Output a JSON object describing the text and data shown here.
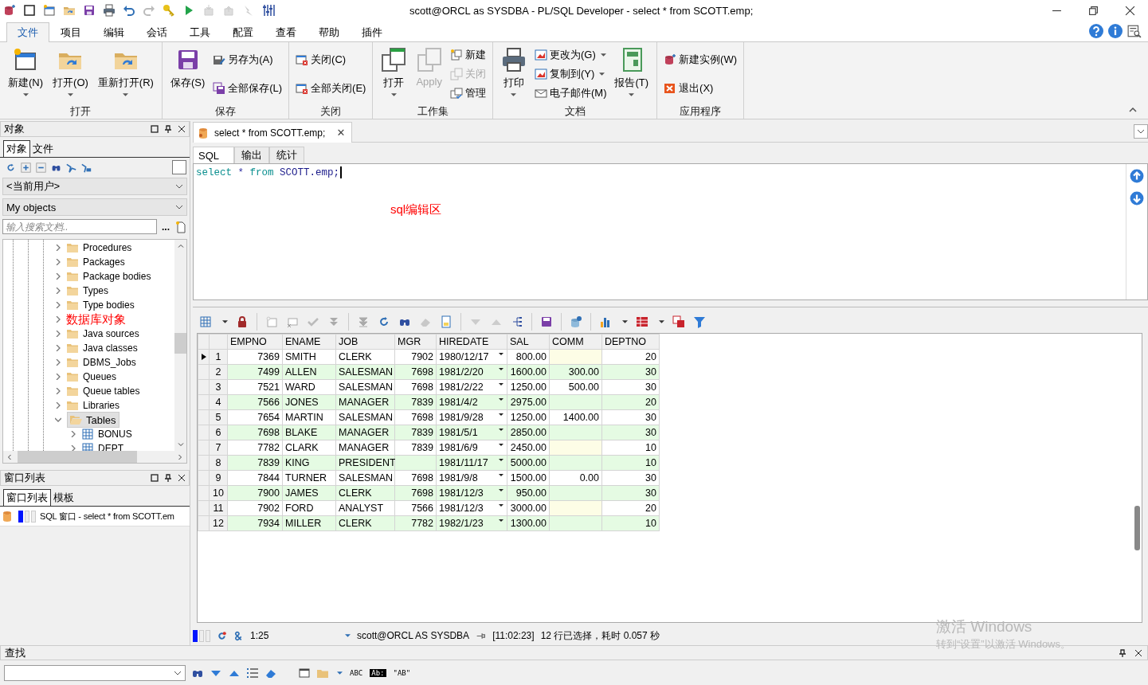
{
  "window": {
    "title": "scott@ORCL as SYSDBA - PL/SQL Developer - select * from SCOTT.emp;"
  },
  "menu_tabs": [
    {
      "label": "文件",
      "selected": true
    },
    {
      "label": "项目",
      "selected": false
    },
    {
      "label": "编辑",
      "selected": false
    },
    {
      "label": "会话",
      "selected": false
    },
    {
      "label": "工具",
      "selected": false
    },
    {
      "label": "配置",
      "selected": false
    },
    {
      "label": "查看",
      "selected": false
    },
    {
      "label": "帮助",
      "selected": false
    },
    {
      "label": "插件",
      "selected": false
    }
  ],
  "ribbon": [
    {
      "label": "打开",
      "buttons": [
        {
          "kind": "large",
          "label": "新建(N)",
          "dropdown": true,
          "disabled": false
        },
        {
          "kind": "large",
          "label": "打开(O)",
          "dropdown": true,
          "disabled": false
        },
        {
          "kind": "large",
          "label": "重新打开(R)",
          "dropdown": true,
          "disabled": false
        }
      ]
    },
    {
      "label": "保存",
      "buttons": [
        {
          "kind": "large",
          "label": "保存(S)",
          "dropdown": false,
          "disabled": false
        },
        {
          "kind": "small",
          "label": "另存为(A)",
          "dropdown": false,
          "disabled": false
        },
        {
          "kind": "small",
          "label": "全部保存(L)",
          "dropdown": false,
          "disabled": false
        }
      ]
    },
    {
      "label": "关闭",
      "buttons": [
        {
          "kind": "small",
          "label": "关闭(C)",
          "dropdown": false,
          "disabled": false
        },
        {
          "kind": "small",
          "label": "全部关闭(E)",
          "dropdown": false,
          "disabled": false
        }
      ]
    },
    {
      "label": "工作集",
      "buttons": [
        {
          "kind": "large",
          "label": "打开",
          "dropdown": true,
          "disabled": false
        },
        {
          "kind": "large",
          "label": "Apply",
          "dropdown": false,
          "disabled": true
        },
        {
          "kind": "small",
          "label": "新建",
          "dropdown": false,
          "disabled": false
        },
        {
          "kind": "small",
          "label": "关闭",
          "dropdown": false,
          "disabled": true
        },
        {
          "kind": "small",
          "label": "管理",
          "dropdown": false,
          "disabled": false
        }
      ]
    },
    {
      "label": "文档",
      "buttons": [
        {
          "kind": "large",
          "label": "打印",
          "dropdown": true,
          "disabled": false
        },
        {
          "kind": "small",
          "label": "更改为(G)",
          "dropdown": true,
          "disabled": false
        },
        {
          "kind": "small",
          "label": "复制到(Y)",
          "dropdown": true,
          "disabled": false
        },
        {
          "kind": "small",
          "label": "电子邮件(M)",
          "dropdown": false,
          "disabled": false
        },
        {
          "kind": "large",
          "label": "报告(T)",
          "dropdown": true,
          "disabled": false
        }
      ]
    },
    {
      "label": "应用程序",
      "buttons": [
        {
          "kind": "small",
          "label": "新建实例(W)",
          "dropdown": false,
          "disabled": false
        },
        {
          "kind": "small",
          "label": "退出(X)",
          "dropdown": false,
          "disabled": false
        }
      ]
    }
  ],
  "objects_panel": {
    "title": "对象",
    "tabs": [
      {
        "label": "对象",
        "selected": true
      },
      {
        "label": "文件",
        "selected": false
      }
    ],
    "owner_select": "<当前用户>",
    "filter_select": "My objects",
    "search": {
      "placeholder": "输入搜索文档.."
    },
    "more_button": "...",
    "tree": [
      {
        "kind": "folder",
        "label": "Procedures",
        "expanded": false,
        "selected": false
      },
      {
        "kind": "folder",
        "label": "Packages",
        "expanded": false,
        "selected": false
      },
      {
        "kind": "folder",
        "label": "Package bodies",
        "expanded": false,
        "selected": false
      },
      {
        "kind": "folder",
        "label": "Types",
        "expanded": false,
        "selected": false
      },
      {
        "kind": "folder",
        "label": "Type bodies",
        "expanded": false,
        "selected": false
      },
      {
        "kind": "folder",
        "annotation": "数据库对象",
        "expanded": false,
        "selected": false
      },
      {
        "kind": "folder",
        "label": "Java sources",
        "expanded": false,
        "selected": false
      },
      {
        "kind": "folder",
        "label": "Java classes",
        "expanded": false,
        "selected": false
      },
      {
        "kind": "folder",
        "label": "DBMS_Jobs",
        "expanded": false,
        "selected": false
      },
      {
        "kind": "folder",
        "label": "Queues",
        "expanded": false,
        "selected": false
      },
      {
        "kind": "folder",
        "label": "Queue tables",
        "expanded": false,
        "selected": false
      },
      {
        "kind": "folder",
        "label": "Libraries",
        "expanded": false,
        "selected": false
      },
      {
        "kind": "folder",
        "label": "Tables",
        "expanded": true,
        "selected": true,
        "children": [
          {
            "kind": "table",
            "label": "BONUS",
            "expanded": false,
            "selected": false
          },
          {
            "kind": "table",
            "label": "DEPT",
            "expanded": false,
            "selected": false
          }
        ]
      }
    ]
  },
  "window_list": {
    "title": "窗口列表",
    "tabs": [
      {
        "label": "窗口列表",
        "selected": true
      },
      {
        "label": "模板",
        "selected": false
      }
    ],
    "items": [
      {
        "label": "SQL 窗口 - select * from SCOTT.em"
      }
    ]
  },
  "document_tab": {
    "label": "select * from SCOTT.emp;",
    "close": "✕"
  },
  "sub_tabs": [
    {
      "label": "SQL",
      "selected": true
    },
    {
      "label": "输出",
      "selected": false
    },
    {
      "label": "统计",
      "selected": false
    }
  ],
  "sql": [
    {
      "text": "select",
      "kind": "keyword"
    },
    {
      "text": "*",
      "kind": "operator"
    },
    {
      "text": "from",
      "kind": "keyword"
    },
    {
      "text": "SCOTT.emp;",
      "kind": "identifier"
    }
  ],
  "editor_annotation": "sql编辑区",
  "grid": {
    "columns": [
      {
        "label": "EMPNO",
        "kind": "number"
      },
      {
        "label": "ENAME",
        "kind": "text"
      },
      {
        "label": "JOB",
        "kind": "text"
      },
      {
        "label": "MGR",
        "kind": "number"
      },
      {
        "label": "HIREDATE",
        "kind": "date"
      },
      {
        "label": "SAL",
        "kind": "number"
      },
      {
        "label": "COMM",
        "kind": "number"
      },
      {
        "label": "DEPTNO",
        "kind": "number"
      }
    ],
    "rows": [
      {
        "number": "1",
        "current": true,
        "cells": [
          "7369",
          "SMITH",
          "CLERK",
          "7902",
          "1980/12/17",
          "800.00",
          null,
          "20"
        ]
      },
      {
        "number": "2",
        "current": false,
        "cells": [
          "7499",
          "ALLEN",
          "SALESMAN",
          "7698",
          "1981/2/20",
          "1600.00",
          "300.00",
          "30"
        ]
      },
      {
        "number": "3",
        "current": false,
        "cells": [
          "7521",
          "WARD",
          "SALESMAN",
          "7698",
          "1981/2/22",
          "1250.00",
          "500.00",
          "30"
        ]
      },
      {
        "number": "4",
        "current": false,
        "cells": [
          "7566",
          "JONES",
          "MANAGER",
          "7839",
          "1981/4/2",
          "2975.00",
          null,
          "20"
        ]
      },
      {
        "number": "5",
        "current": false,
        "cells": [
          "7654",
          "MARTIN",
          "SALESMAN",
          "7698",
          "1981/9/28",
          "1250.00",
          "1400.00",
          "30"
        ]
      },
      {
        "number": "6",
        "current": false,
        "cells": [
          "7698",
          "BLAKE",
          "MANAGER",
          "7839",
          "1981/5/1",
          "2850.00",
          null,
          "30"
        ]
      },
      {
        "number": "7",
        "current": false,
        "cells": [
          "7782",
          "CLARK",
          "MANAGER",
          "7839",
          "1981/6/9",
          "2450.00",
          null,
          "10"
        ]
      },
      {
        "number": "8",
        "current": false,
        "cells": [
          "7839",
          "KING",
          "PRESIDENT",
          null,
          "1981/11/17",
          "5000.00",
          null,
          "10"
        ]
      },
      {
        "number": "9",
        "current": false,
        "cells": [
          "7844",
          "TURNER",
          "SALESMAN",
          "7698",
          "1981/9/8",
          "1500.00",
          "0.00",
          "30"
        ]
      },
      {
        "number": "10",
        "current": false,
        "cells": [
          "7900",
          "JAMES",
          "CLERK",
          "7698",
          "1981/12/3",
          "950.00",
          null,
          "30"
        ]
      },
      {
        "number": "11",
        "current": false,
        "cells": [
          "7902",
          "FORD",
          "ANALYST",
          "7566",
          "1981/12/3",
          "3000.00",
          null,
          "20"
        ]
      },
      {
        "number": "12",
        "current": false,
        "cells": [
          "7934",
          "MILLER",
          "CLERK",
          "7782",
          "1982/1/23",
          "1300.00",
          null,
          "10"
        ]
      }
    ]
  },
  "status_bar": {
    "position": "1:25",
    "connection": "scott@ORCL AS SYSDBA",
    "time": "[11:02:23]",
    "message": "12 行已选择，耗时 0.057 秒"
  },
  "find_panel": {
    "title": "查找",
    "labels": [
      "ABC",
      "Ab:",
      "\"AB\""
    ]
  },
  "activation_notice": {
    "title": "激活 Windows",
    "message": "转到“设置”以激活 Windows。"
  }
}
